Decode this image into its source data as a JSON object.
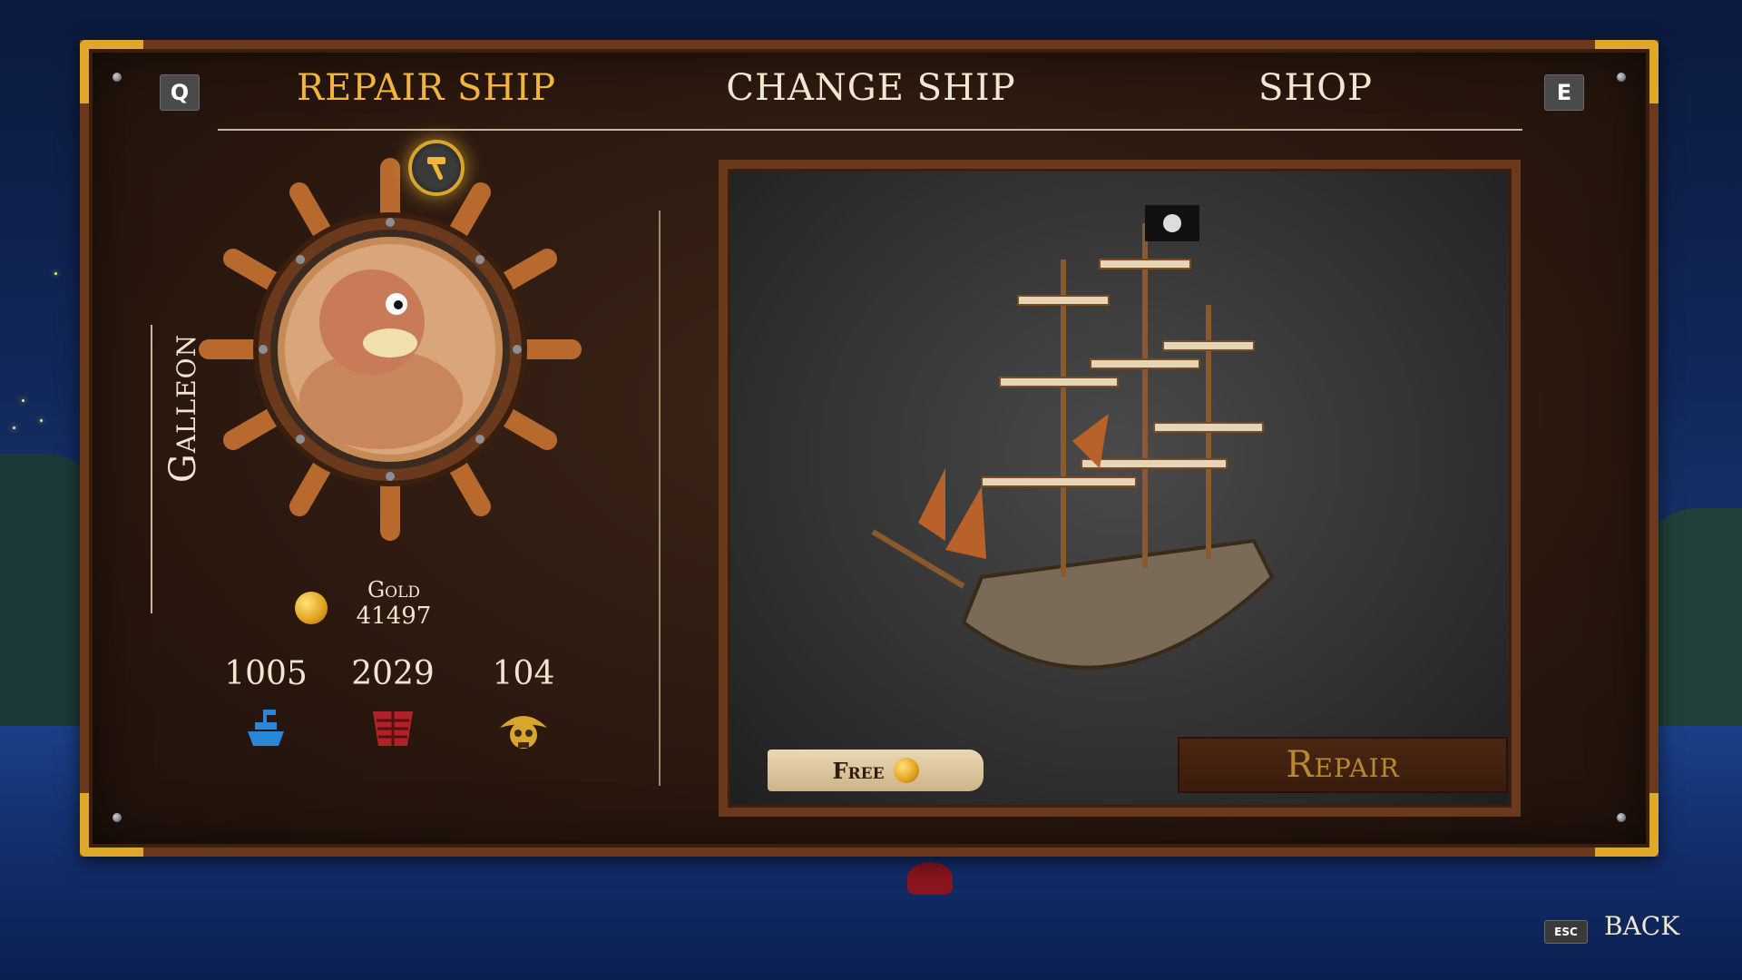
{
  "tabs": {
    "left_key": "Q",
    "right_key": "E",
    "items": [
      {
        "label": "REPAIR SHIP",
        "active": true
      },
      {
        "label": "CHANGE SHIP",
        "active": false
      },
      {
        "label": "SHOP",
        "active": false
      }
    ]
  },
  "ship": {
    "class_label": "Galleon"
  },
  "gold": {
    "label": "Gold",
    "value": "41497"
  },
  "stats": [
    {
      "value": "1005",
      "icon": "ship-hull-icon"
    },
    {
      "value": "2029",
      "icon": "armor-plating-icon"
    },
    {
      "value": "104",
      "icon": "pirate-skull-icon"
    }
  ],
  "repair": {
    "price_label": "Free",
    "button_label": "Repair"
  },
  "back": {
    "key": "ESC",
    "label": "BACK"
  },
  "colors": {
    "active_tab": "#f2b43a",
    "text": "#f1e6d0",
    "frame_gold": "#e0a82a",
    "wood": "#6b3a1c"
  }
}
